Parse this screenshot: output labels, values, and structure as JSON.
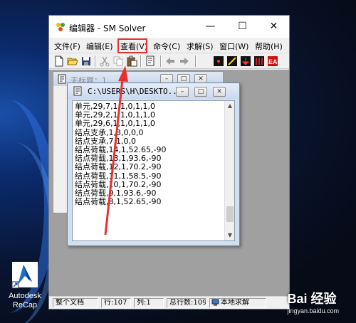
{
  "desktop": {
    "shortcut": {
      "label_line1": "Autodesk",
      "label_line2": "ReCap"
    }
  },
  "window": {
    "title": "编辑器 - SM Solver",
    "controls": {
      "minimize": "—",
      "maximize": "☐",
      "close": "✕"
    }
  },
  "menu": [
    {
      "label": "文件(F)"
    },
    {
      "label": "编辑(E)"
    },
    {
      "label": "查看(V)"
    },
    {
      "label": "命令(C)"
    },
    {
      "label": "求解(S)"
    },
    {
      "label": "窗口(W)"
    },
    {
      "label": "帮助(H)"
    }
  ],
  "mdi_back": {
    "title": "无标题：1"
  },
  "mdi_front": {
    "title": "C:\\USERS\\H\\DESKTO...",
    "lines": [
      "单元,29,7,1,1,0,1,1,0",
      "单元,29,2,1,1,0,1,1,0",
      "单元,29,6,1,1,0,1,1,0",
      "结点支承,1,3,0,0,0",
      "结点支承,7,1,0,0",
      "结点荷载,14,1,52.65,-90",
      "结点荷载,13,1,93.6,-90",
      "结点荷载,12,1,70.2,-90",
      "结点荷载,11,1,58.5,-90",
      "结点荷载,10,1,70.2,-90",
      "结点荷载,9,1,93.6,-90",
      "结点荷载,8,1,52.65,-90"
    ]
  },
  "status": {
    "scope": "整个文档",
    "row": "行:107",
    "col": "列:1",
    "total": "总行数:109",
    "mode": "本地求解"
  },
  "watermark": {
    "brand": "Bai 经验",
    "url": "jingyan.baidu.com"
  }
}
